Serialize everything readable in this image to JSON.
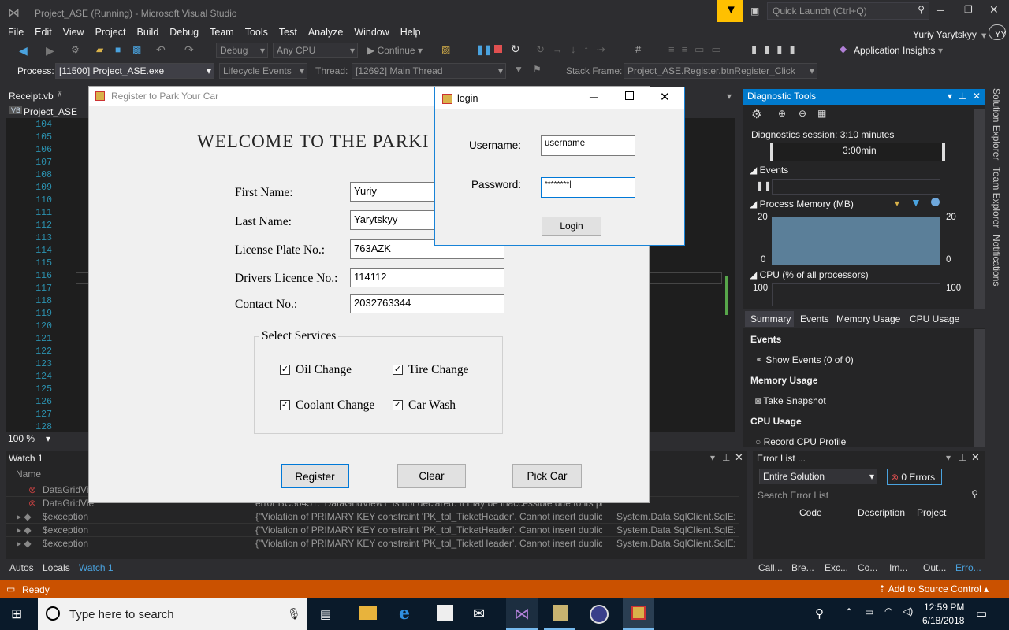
{
  "app": {
    "title": "Project_ASE (Running) - Microsoft Visual Studio",
    "quick_launch": "Quick Launch (Ctrl+Q)",
    "user": "Yuriy Yarytskyy",
    "user_initials": "YY"
  },
  "menu": [
    "File",
    "Edit",
    "View",
    "Project",
    "Build",
    "Debug",
    "Team",
    "Tools",
    "Test",
    "Analyze",
    "Window",
    "Help"
  ],
  "toolbar": {
    "config": "Debug",
    "platform": "Any CPU",
    "continue": "Continue",
    "insights": "Application Insights"
  },
  "toolbar2": {
    "process_label": "Process:",
    "process": "[11500] Project_ASE.exe",
    "lifecycle": "Lifecycle Events",
    "thread_label": "Thread:",
    "thread": "[12692] Main Thread",
    "stackframe_label": "Stack Frame:",
    "stackframe": "Project_ASE.Register.btnRegister_Click"
  },
  "editor": {
    "file_tab": "Receipt.vb",
    "project": "Project_ASE",
    "zoom": "100 %",
    "line_numbers": [
      "104",
      "105",
      "106",
      "107",
      "108",
      "109",
      "110",
      "111",
      "112",
      "113",
      "114",
      "115",
      "116",
      "117",
      "118",
      "119",
      "120",
      "121",
      "122",
      "123",
      "124",
      "125",
      "126",
      "127",
      "128"
    ]
  },
  "register": {
    "title": "Register to Park Your Car",
    "welcome": "WELCOME TO THE PARKI",
    "fields": [
      {
        "label": "First Name:",
        "value": "Yuriy"
      },
      {
        "label": "Last Name:",
        "value": "Yarytskyy"
      },
      {
        "label": "License Plate No.:",
        "value": "763AZK"
      },
      {
        "label": "Drivers Licence No.:",
        "value": "114112"
      },
      {
        "label": "Contact No.:",
        "value": "2032763344"
      }
    ],
    "services_title": "Select Services",
    "services": [
      "Oil Change",
      "Tire Change",
      "Coolant Change",
      "Car Wash"
    ],
    "buttons": {
      "register": "Register",
      "clear": "Clear",
      "pick": "Pick Car"
    }
  },
  "login": {
    "title": "login",
    "username_label": "Username:",
    "username": "username",
    "password_label": "Password:",
    "password": "********",
    "button": "Login"
  },
  "diagnostics": {
    "title": "Diagnostic Tools",
    "session": "Diagnostics session: 3:10 minutes",
    "timeline": "3:00min",
    "events": "Events",
    "memory": "Process Memory (MB)",
    "mem_max": "20",
    "mem_min": "0",
    "cpu": "CPU (% of all processors)",
    "cpu_max": "100",
    "tabs": [
      "Summary",
      "Events",
      "Memory Usage",
      "CPU Usage"
    ],
    "sections": [
      {
        "title": "Events",
        "action": "Show Events (0 of 0)"
      },
      {
        "title": "Memory Usage",
        "action": "Take Snapshot"
      },
      {
        "title": "CPU Usage",
        "action": "Record CPU Profile"
      }
    ]
  },
  "side_tabs": [
    "Solution Explorer",
    "Team Explorer",
    "Notifications"
  ],
  "watch": {
    "title": "Watch 1",
    "col": "Name",
    "rows": [
      {
        "name": "DataGridVi",
        "value": "",
        "type": ""
      },
      {
        "name": "DataGridVie",
        "value": "error BC30451: 'DataGridView1' is not declared. It may be inaccessible due to its pro",
        "type": ""
      },
      {
        "name": "$exception",
        "value": "{\"Violation of PRIMARY KEY constraint 'PK_tbl_TicketHeader'. Cannot insert duplica",
        "type": "System.Data.SqlClient.SqlEx"
      },
      {
        "name": "$exception",
        "value": "{\"Violation of PRIMARY KEY constraint 'PK_tbl_TicketHeader'. Cannot insert duplica",
        "type": "System.Data.SqlClient.SqlEx"
      },
      {
        "name": "$exception",
        "value": "{\"Violation of PRIMARY KEY constraint 'PK_tbl_TicketHeader'. Cannot insert duplica",
        "type": "System.Data.SqlClient.SqlEx"
      }
    ]
  },
  "errors": {
    "title": "Error List ...",
    "scope": "Entire Solution",
    "count": "0 Errors",
    "search": "Search Error List",
    "cols": [
      "Code",
      "Description",
      "Project"
    ]
  },
  "bottom_tabs_left": [
    "Autos",
    "Locals",
    "Watch 1"
  ],
  "bottom_tabs_right": [
    "Call...",
    "Bre...",
    "Exc...",
    "Co...",
    "Im...",
    "Out...",
    "Erro..."
  ],
  "status": {
    "ready": "Ready",
    "source_control": "Add to Source Control"
  },
  "taskbar": {
    "search": "Type here to search",
    "time": "12:59 PM",
    "date": "6/18/2018"
  }
}
